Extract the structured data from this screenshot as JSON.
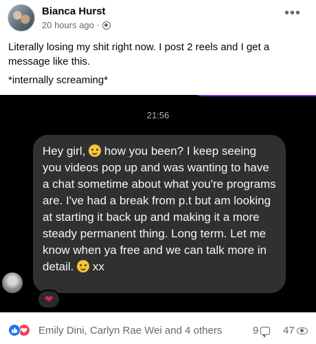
{
  "post": {
    "author": "Bianca Hurst",
    "time": "20 hours ago",
    "separator": "·",
    "more": "•••",
    "text_lines": [
      "Literally losing my shit right now. I post 2 reels and I get a message like this.",
      "*internally screaming*"
    ]
  },
  "chat": {
    "timestamp": "21:56",
    "message_part1": "Hey girl, ",
    "message_part2": " how you been? I keep seeing you videos pop up and was wanting to have  a chat sometime about what you're programs are. I've had a break from p.t but am looking at starting it back up and making it a more steady permanent thing. Long term. Let me know when ya free and we can talk more in detail. ",
    "message_part3": " xx",
    "reaction": "❤"
  },
  "footer": {
    "reactors": "Emily Dini, Carlyn Rae Wei and 4 others",
    "comments": "9",
    "views": "47"
  },
  "colors": {
    "like_blue": "#1877f2",
    "love_red": "#f33e58",
    "bubble_bg": "#303030",
    "accent_purple": "#7b2ff7"
  }
}
